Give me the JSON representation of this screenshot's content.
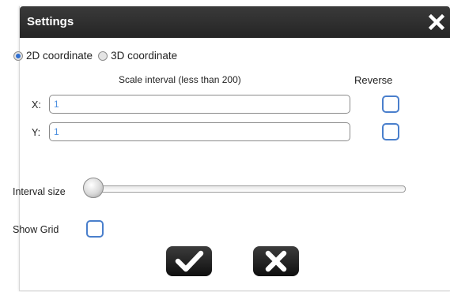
{
  "dialog": {
    "title": "Settings",
    "close_icon": "close-icon"
  },
  "coordinate": {
    "options": [
      "2D coordinate",
      "3D coordinate"
    ],
    "selected": "2D coordinate"
  },
  "scale": {
    "header": "Scale interval (less than 200)",
    "reverse_header": "Reverse",
    "x_label": "X:",
    "x_value": "1",
    "y_label": "Y:",
    "y_value": "1",
    "x_reverse": false,
    "y_reverse": false
  },
  "interval": {
    "label": "Interval size",
    "level": 0
  },
  "grid": {
    "label": "Show Grid",
    "checked": false
  },
  "actions": {
    "confirm_icon": "checkmark-icon",
    "cancel_icon": "cross-icon"
  },
  "colors": {
    "titlebar": "#2b2b2b",
    "accent": "#4a7fcc",
    "value_text": "#4d90e0"
  }
}
